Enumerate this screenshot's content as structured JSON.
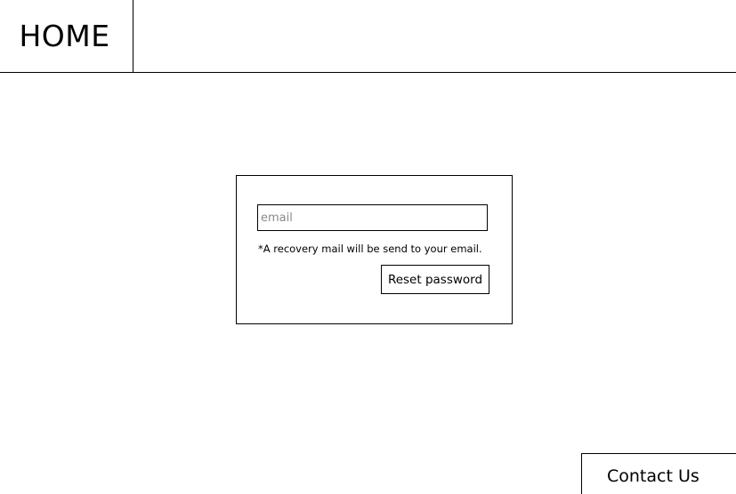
{
  "header": {
    "home_label": "HOME"
  },
  "reset_form": {
    "email_value": "",
    "email_placeholder": "email",
    "hint_text": "*A recovery mail will be send to your email.",
    "reset_button_label": "Reset password"
  },
  "footer": {
    "contact_label": "Contact Us"
  }
}
